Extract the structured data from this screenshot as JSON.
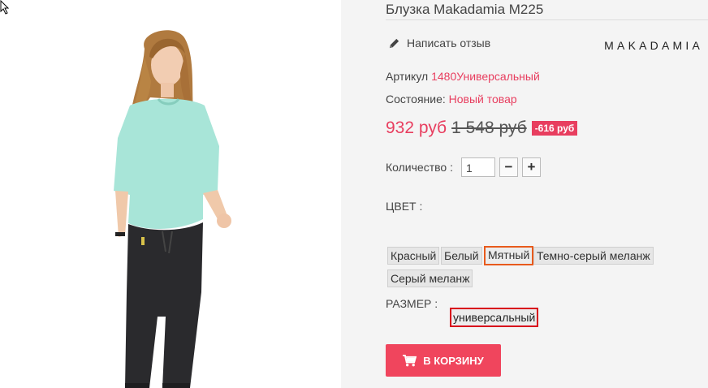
{
  "product": {
    "title": "Блузка Makadamia M225",
    "write_review": "Написать отзыв",
    "brand": "MAKADAMIA",
    "sku_label": "Артикул",
    "sku_value": "1480Универсальный",
    "condition_label": "Состояние:",
    "condition_value": "Новый товар",
    "price": "932 руб",
    "old_price": "1 548 руб",
    "discount": "-616 руб",
    "quantity_label": "Количество :",
    "quantity_value": "1",
    "minus": "−",
    "plus": "+",
    "color_label": "ЦВЕТ :",
    "colors": [
      "Красный",
      "Белый",
      "Мятный",
      "Темно-серый меланж",
      "Серый меланж"
    ],
    "selected_color": "Мятный",
    "size_label": "РАЗМЕР :",
    "size_value": "универсальный",
    "cart_button": "В КОРЗИНУ"
  },
  "icons": {
    "review": "pencil-icon",
    "cart": "shopping-cart-icon"
  },
  "colors": {
    "accent": "#e83e5f",
    "cart_button": "#f0455d",
    "selected_border": "#e85a1c",
    "size_border": "#d8001a"
  }
}
